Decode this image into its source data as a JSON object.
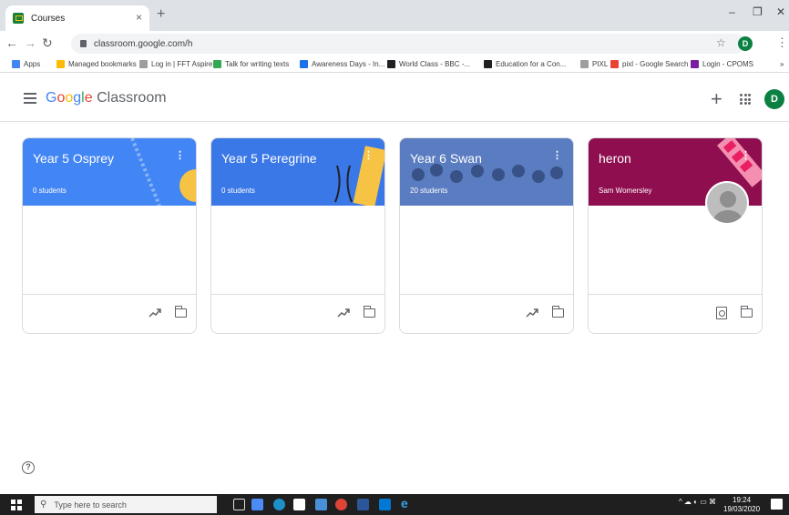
{
  "browser": {
    "tab_title": "Courses",
    "tab_close": "×",
    "new_tab": "+",
    "url": "classroom.google.com/h",
    "window_controls": [
      "–",
      "❐",
      "✕"
    ]
  },
  "bookmarks": [
    {
      "label": "Apps",
      "color": "#4285f4"
    },
    {
      "label": "Managed bookmarks",
      "color": "#fbbc04"
    },
    {
      "label": "Log in | FFT Aspire",
      "color": "#9e9e9e"
    },
    {
      "label": "Talk for writing texts",
      "color": "#34a853"
    },
    {
      "label": "Awareness Days - In...",
      "color": "#1a73e8"
    },
    {
      "label": "World Class - BBC -...",
      "color": "#202124"
    },
    {
      "label": "Education for a Con...",
      "color": "#202124"
    },
    {
      "label": "PIXL",
      "color": "#9e9e9e"
    },
    {
      "label": "pixl - Google Search",
      "color": "#ea4335"
    },
    {
      "label": "Login - CPOMS",
      "color": "#7b1fa2"
    }
  ],
  "bookmarks_overflow": "»",
  "app": {
    "brand_google": "Google",
    "brand_classroom": "Classroom",
    "plus": "+",
    "user_initial": "D"
  },
  "courses": [
    {
      "title": "Year 5 Osprey",
      "subtitle": "0 students",
      "banner_color": "#4285f4",
      "footer_icons": [
        "trending-up-icon",
        "folder-icon"
      ]
    },
    {
      "title": "Year 5 Peregrine",
      "subtitle": "0 students",
      "banner_color": "#3b78e7",
      "footer_icons": [
        "trending-up-icon",
        "folder-icon"
      ]
    },
    {
      "title": "Year 6 Swan",
      "subtitle": "20 students",
      "banner_color": "#4a73c9",
      "footer_icons": [
        "trending-up-icon",
        "folder-icon"
      ]
    },
    {
      "title": "heron",
      "subtitle": "Sam Womersley",
      "banner_color": "#8e0e4f",
      "footer_icons": [
        "assignment-ind-icon",
        "folder-icon"
      ]
    }
  ],
  "help": "?",
  "taskbar": {
    "search_placeholder": "Type here to search",
    "time": "19:24",
    "date": "19/03/2020"
  }
}
